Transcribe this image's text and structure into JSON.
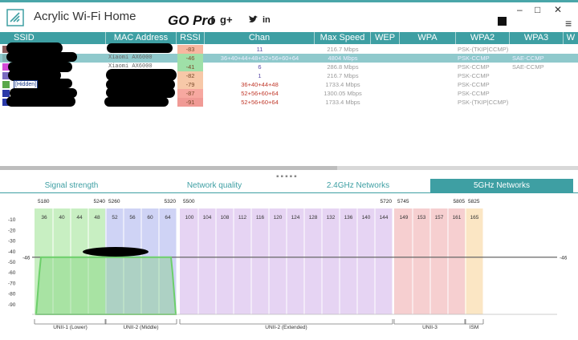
{
  "window": {
    "title": "Acrylic Wi-Fi Home",
    "edition": "GO Pro",
    "social": [
      "f",
      "g+",
      "t",
      "in"
    ],
    "controls": [
      "–",
      "□",
      "✕"
    ],
    "icons": [
      "wifi-logo-icon",
      "stop-icon",
      "hamburger-menu-icon",
      "facebook-icon",
      "google-plus-icon",
      "twitter-icon",
      "linkedin-icon"
    ]
  },
  "table": {
    "columns": [
      "SSID",
      "MAC Address",
      "RSSI",
      "Chan",
      "Max Speed",
      "WEP",
      "WPA",
      "WPA2",
      "WPA3",
      "W"
    ],
    "rows": [
      {
        "color": "#8b5a5a",
        "ssid": "",
        "mac": "",
        "rssi": "-83",
        "rssi_color": "#f7b7a0",
        "chan": "11",
        "chan_color": "#5a4aa8",
        "speed": "216.7 Mbps",
        "wpa2": "PSK-(TKIP|CCMP)",
        "wpa3": ""
      },
      {
        "color": "#7fb0b0",
        "ssid": "",
        "mac": "Xiaomi AX6000",
        "rssi": "-46",
        "rssi_color": "#9fe0a8",
        "chan": "36+40+44+48+52+56+60+64",
        "chan_color": "#eef",
        "speed": "4804 Mbps",
        "wpa2": "PSK-CCMP",
        "wpa3": "SAE-CCMP",
        "selected": true
      },
      {
        "color": "#d24ad6",
        "ssid": "",
        "mac": "Xiaomi AX6000",
        "rssi": "-41",
        "rssi_color": "#9fe0a8",
        "chan": "6",
        "chan_color": "#5a4aa8",
        "speed": "286.8 Mbps",
        "wpa2": "PSK-CCMP",
        "wpa3": "SAE-CCMP"
      },
      {
        "color": "#7a6cc0",
        "ssid": "",
        "mac": "",
        "rssi": "-82",
        "rssi_color": "#f7c8a8",
        "chan": "1",
        "chan_color": "#5a4aa8",
        "speed": "216.7 Mbps",
        "wpa2": "PSK-CCMP",
        "wpa3": ""
      },
      {
        "color": "#5aa84a",
        "ssid": "[Hidden]",
        "mac": "",
        "rssi": "-79",
        "rssi_color": "#f7c8a8",
        "chan": "36+40+44+48",
        "chan_color": "#c0392b",
        "speed": "1733.4 Mbps",
        "wpa2": "PSK-CCMP",
        "wpa3": ""
      },
      {
        "color": "#2a3aa8",
        "ssid": "",
        "mac": "",
        "rssi": "-87",
        "rssi_color": "#f7a8a0",
        "chan": "52+56+60+64",
        "chan_color": "#c0392b",
        "speed": "1300.05 Mbps",
        "wpa2": "PSK-CCMP",
        "wpa3": ""
      },
      {
        "color": "#2a3aa8",
        "ssid": "",
        "mac": "",
        "rssi": "-91",
        "rssi_color": "#f09a95",
        "chan": "52+56+60+64",
        "chan_color": "#c0392b",
        "speed": "1733.4 Mbps",
        "wpa2": "PSK-(TKIP|CCMP)",
        "wpa3": ""
      }
    ]
  },
  "tabs": {
    "items": [
      "Signal strength",
      "Network quality",
      "2.4GHz Networks",
      "5GHz Networks"
    ],
    "active": 3
  },
  "chart_data": {
    "type": "area",
    "freq_labels": [
      "5180",
      "5240",
      "5260",
      "5320",
      "5500",
      "5720",
      "5745",
      "5805",
      "5825"
    ],
    "channels": [
      36,
      40,
      44,
      48,
      52,
      56,
      60,
      64,
      100,
      104,
      108,
      112,
      116,
      120,
      124,
      128,
      132,
      136,
      140,
      144,
      149,
      153,
      157,
      161,
      165
    ],
    "y_ticks": [
      -10,
      -20,
      -30,
      -40,
      -50,
      -60,
      -70,
      -80,
      -90
    ],
    "ylim": [
      -100,
      0
    ],
    "threshold": -46,
    "threshold_label": "-46",
    "bands": [
      {
        "label": "UNII-1 (Lower)",
        "from": 36,
        "to": 48,
        "color": "#c8efc2"
      },
      {
        "label": "UNII-2 (Middle)",
        "from": 52,
        "to": 64,
        "color": "#cfd3f5"
      },
      {
        "label": "UNII-2 (Extended)",
        "from": 100,
        "to": 144,
        "color": "#e6d4f3"
      },
      {
        "label": "UNII-3",
        "from": 149,
        "to": 161,
        "color": "#f6cfd0"
      },
      {
        "label": "ISM",
        "from": 165,
        "to": 165,
        "color": "#fbe6c4"
      }
    ],
    "series": [
      {
        "channels_from": 36,
        "channels_to": 64,
        "rssi": -46,
        "color": "#6ccf6a"
      }
    ]
  }
}
